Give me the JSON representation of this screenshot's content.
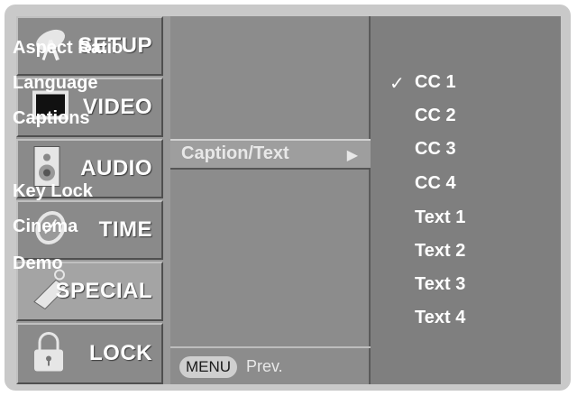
{
  "categories": [
    {
      "label": "SETUP",
      "icon": "satellite-dish-icon"
    },
    {
      "label": "VIDEO",
      "icon": "tv-screen-icon"
    },
    {
      "label": "AUDIO",
      "icon": "speaker-icon"
    },
    {
      "label": "TIME",
      "icon": "clock-icon"
    },
    {
      "label": "SPECIAL",
      "icon": "tag-icon"
    },
    {
      "label": "LOCK",
      "icon": "padlock-icon"
    }
  ],
  "active_category": "SPECIAL",
  "menu": {
    "items": [
      "Aspect Ratio",
      "Language",
      "Captions",
      "Caption/Text",
      "Key Lock",
      "Cinema",
      "Demo"
    ],
    "selected": "Caption/Text",
    "arrow": "▶",
    "menu_button": "MENU",
    "prev_label": "Prev."
  },
  "options": {
    "items": [
      "CC 1",
      "CC 2",
      "CC 3",
      "CC 4",
      "Text 1",
      "Text 2",
      "Text 3",
      "Text 4"
    ],
    "checked": "CC 1",
    "check_mark": "✓"
  }
}
